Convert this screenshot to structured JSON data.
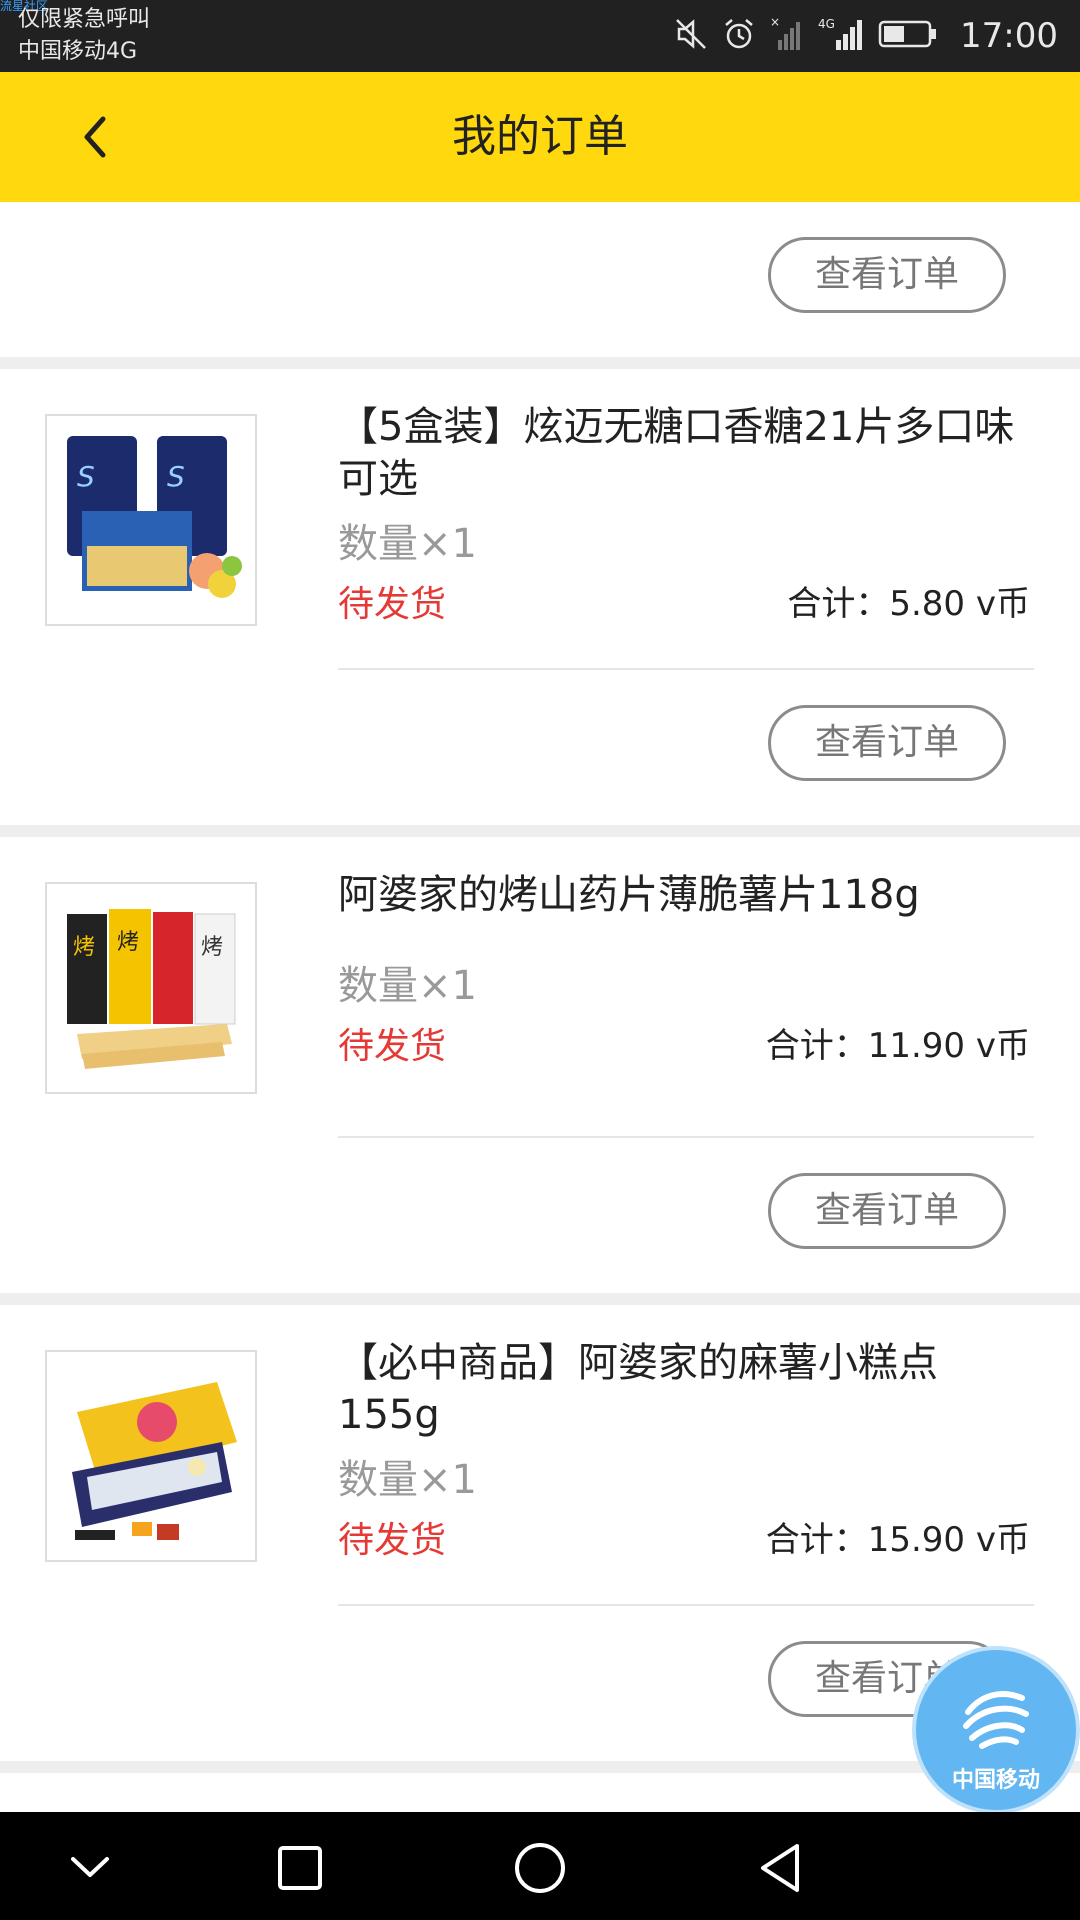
{
  "status_bar": {
    "watermark": "流星社区",
    "line1": "仅限紧急呼叫",
    "line2": "中国移动4G",
    "time": "17:00",
    "network_label": "4G"
  },
  "header": {
    "title": "我的订单",
    "background_color": "#ffd90d"
  },
  "orders": [
    {
      "view_button": "查看订单"
    },
    {
      "title": "【5盒装】炫迈无糖口香糖21片多口味可选",
      "quantity": "数量×1",
      "status": "待发货",
      "total": "合计：5.80 v币",
      "view_button": "查看订单"
    },
    {
      "title": "阿婆家的烤山药片薄脆薯片118g",
      "quantity": "数量×1",
      "status": "待发货",
      "total": "合计：11.90 v币",
      "view_button": "查看订单"
    },
    {
      "title": "【必中商品】阿婆家的麻薯小糕点155g",
      "quantity": "数量×1",
      "status": "待发货",
      "total": "合计：15.90 v币",
      "view_button": "查看订单"
    }
  ],
  "floating_badge": {
    "label": "中国移动"
  },
  "colors": {
    "status_red": "#e53935",
    "accent_yellow": "#ffd90d"
  }
}
